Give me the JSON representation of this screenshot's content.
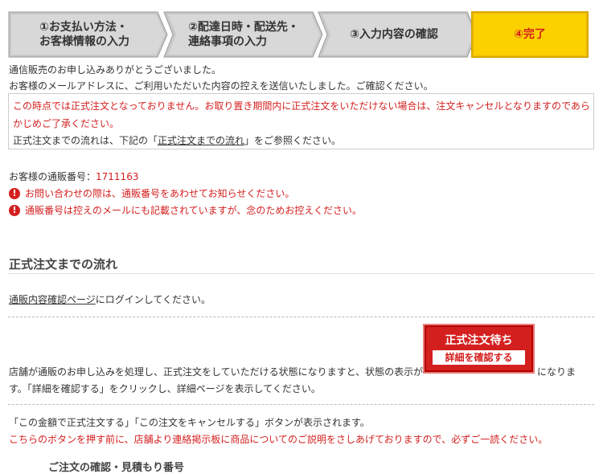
{
  "steps": [
    {
      "line1": "①お支払い方法・",
      "line2": "お客様情報の入力"
    },
    {
      "line1": "②配達日時・配送先・",
      "line2": "連絡事項の入力"
    },
    {
      "line1": "③入力内容の確認",
      "line2": ""
    },
    {
      "line1": "④完了",
      "line2": ""
    }
  ],
  "thanks": "通信販売のお申し込みありがとうございました。",
  "email_sent": "お客様のメールアドレスに、ご利用いただいた内容の控えを送信いたしました。ご確認ください。",
  "notice": {
    "line1": "この時点では正式注文となっておりません。お取り置き期間内に正式注文をいただけない場合は、注文キャンセルとなりますのであら",
    "line2": "かじめご了承ください。",
    "line3_pre": "正式注文までの流れは、下記の「",
    "line3_link": "正式注文までの流れ",
    "line3_post": "」をご参照ください。"
  },
  "order": {
    "label": "お客様の通販番号：",
    "number": "1711163"
  },
  "alerts": [
    "お問い合わせの際は、通販番号をあわせてお知らせください。",
    "通販番号は控えのメールにも記載されていますが、念のためお控えください。"
  ],
  "flow": {
    "heading": "正式注文までの流れ",
    "login_link": "通販内容確認ページ",
    "login_post": "にログインしてください。",
    "step2_pre": "店舗が通販のお申し込みを処理し、正式注文をしていただける状態になりますと、状態の表示が",
    "step2_post": "になりま",
    "step2_line2": "す。「詳細を確認する」をクリックし、詳細ページを表示してください。",
    "badge_title": "正式注文待ち",
    "badge_button": "詳細を確認する",
    "step3_line1": "「この金額で正式注文する」「この注文をキャンセルする」ボタンが表示されます。",
    "step3_line2": "こちらのボタンを押す前に、店舗より連絡掲示板に商品についてのご説明をさしあげておりますので、必ずご一読ください。",
    "cut_off": "ご注文の確認・見積もり番号"
  },
  "colors": {
    "accent_red": "#d41f1f",
    "active_step": "#f5c400",
    "inactive_step": "#c8c8c8"
  }
}
